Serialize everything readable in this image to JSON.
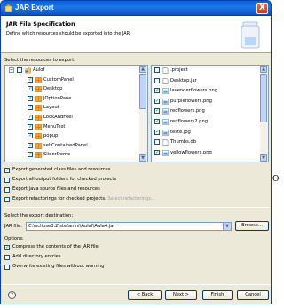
{
  "window": {
    "title": "JAR Export",
    "close_label": "X"
  },
  "header": {
    "title": "JAR File Specification",
    "description": "Define which resources should be exported into the JAR."
  },
  "resources_label": "Select the resources to export:",
  "tree": [
    {
      "label": "Aulof",
      "checked": false,
      "expanded": true,
      "level": 0,
      "icon": "project-folder-icon"
    },
    {
      "label": "CustomPanel",
      "checked": true,
      "level": 1,
      "icon": "package-icon"
    },
    {
      "label": "Desktop",
      "checked": true,
      "level": 1,
      "icon": "package-icon"
    },
    {
      "label": "JOptionPane",
      "checked": true,
      "level": 1,
      "icon": "package-icon"
    },
    {
      "label": "Layout",
      "checked": true,
      "level": 1,
      "icon": "package-icon"
    },
    {
      "label": "LookAndFeel",
      "checked": true,
      "level": 1,
      "icon": "package-icon"
    },
    {
      "label": "MenuTest",
      "checked": true,
      "level": 1,
      "icon": "package-icon"
    },
    {
      "label": "popup",
      "checked": true,
      "level": 1,
      "icon": "package-icon"
    },
    {
      "label": "selfContainedPanel",
      "checked": true,
      "level": 1,
      "icon": "package-icon"
    },
    {
      "label": "SliderDemo",
      "checked": true,
      "level": 1,
      "icon": "package-icon"
    }
  ],
  "files": [
    {
      "label": ".project",
      "checked": false,
      "icon": "file-icon"
    },
    {
      "label": "Desktop.jar",
      "checked": false,
      "icon": "file-icon"
    },
    {
      "label": "lavenderflowers.png",
      "checked": true,
      "icon": "image-file-icon"
    },
    {
      "label": "purpleflowers.png",
      "checked": true,
      "icon": "image-file-icon"
    },
    {
      "label": "redflowers.png",
      "checked": true,
      "icon": "image-file-icon"
    },
    {
      "label": "redflowers2.png",
      "checked": true,
      "icon": "image-file-icon"
    },
    {
      "label": "teste.jpg",
      "checked": true,
      "icon": "image-file-icon"
    },
    {
      "label": "Thumbs.db",
      "checked": false,
      "icon": "file-icon"
    },
    {
      "label": "yellowflowers.png",
      "checked": true,
      "icon": "image-file-icon"
    }
  ],
  "export_options": [
    {
      "label": "Export generated class files and resources",
      "checked": true
    },
    {
      "label": "Export all output folders for checked projects",
      "checked": false
    },
    {
      "label": "Export java source files and resources",
      "checked": false
    },
    {
      "label": "Export refactorings for checked projects.",
      "checked": false,
      "link": "Select refactorings..."
    }
  ],
  "destination": {
    "label": "Select the export destination:",
    "jar_file_label": "JAR file:",
    "jar_file_value": "C:\\eclipse3.2\\stefanini\\Aulaf\\Aula4.jar",
    "browse_label": "Browse..."
  },
  "options": {
    "label": "Options:",
    "items": [
      {
        "label": "Compress the contents of the JAR file",
        "checked": true
      },
      {
        "label": "Add directory entries",
        "checked": false
      },
      {
        "label": "Overwrite existing files without warning",
        "checked": false
      }
    ]
  },
  "buttons": {
    "help": "?",
    "back": "< Back",
    "next": "Next >",
    "finish": "Finish",
    "cancel": "Cancel"
  },
  "side_letter": "O",
  "colors": {
    "title_bar": "#1b78e8",
    "dialog_bg": "#ece9d8",
    "check_green": "#21a121",
    "package_orange": "#e07b00"
  }
}
